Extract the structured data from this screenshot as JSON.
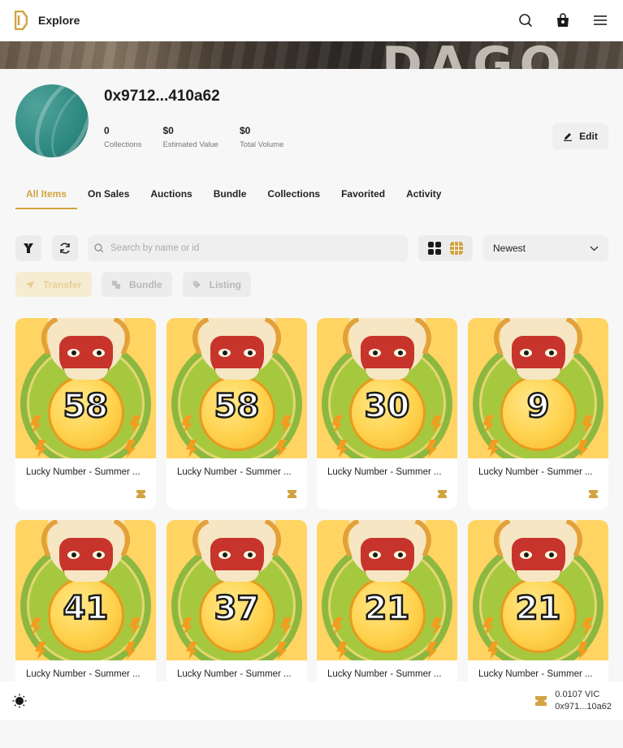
{
  "header": {
    "title": "Explore",
    "icons": [
      "search-icon",
      "bag-icon",
      "menu-icon"
    ]
  },
  "banner": {
    "text": "DAGO"
  },
  "profile": {
    "wallet": "0x9712...410a62",
    "stats": [
      {
        "value": "0",
        "label": "Collections"
      },
      {
        "value": "$0",
        "label": "Estimated Value"
      },
      {
        "value": "$0",
        "label": "Total Volume"
      }
    ],
    "edit_label": "Edit"
  },
  "tabs": [
    {
      "label": "All Items",
      "active": true
    },
    {
      "label": "On Sales"
    },
    {
      "label": "Auctions"
    },
    {
      "label": "Bundle"
    },
    {
      "label": "Collections"
    },
    {
      "label": "Favorited"
    },
    {
      "label": "Activity"
    }
  ],
  "toolbar": {
    "search_placeholder": "Search by name or id",
    "sort_value": "Newest",
    "actions": {
      "transfer": "Transfer",
      "bundle": "Bundle",
      "listing": "Listing"
    }
  },
  "items": [
    {
      "number": "58",
      "name": "Lucky Number - Summer ..."
    },
    {
      "number": "58",
      "name": "Lucky Number - Summer ..."
    },
    {
      "number": "30",
      "name": "Lucky Number - Summer ..."
    },
    {
      "number": "9",
      "name": "Lucky Number - Summer ..."
    },
    {
      "number": "41",
      "name": "Lucky Number - Summer ..."
    },
    {
      "number": "37",
      "name": "Lucky Number - Summer ..."
    },
    {
      "number": "21",
      "name": "Lucky Number - Summer ..."
    },
    {
      "number": "21",
      "name": "Lucky Number - Summer ..."
    }
  ],
  "footer": {
    "balance": "0.0107 VIC",
    "address": "0x971...10a62"
  },
  "colors": {
    "accent": "#d1a341",
    "background": "#f7f7f7"
  }
}
